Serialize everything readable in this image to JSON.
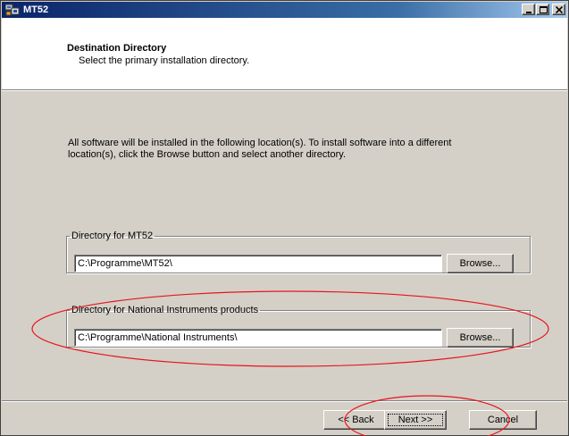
{
  "window": {
    "title": "MT52"
  },
  "header": {
    "title": "Destination Directory",
    "subtitle": "Select the primary installation directory."
  },
  "intro_text": "All software will be installed in the following location(s). To install software into a different location(s), click the Browse button and select another directory.",
  "groups": [
    {
      "label": "Directory for MT52",
      "path": "C:\\Programme\\MT52\\",
      "browse_label": "Browse..."
    },
    {
      "label": "Directory for National Instruments products",
      "path": "C:\\Programme\\National Instruments\\",
      "browse_label": "Browse..."
    }
  ],
  "footer": {
    "back_label": "<< Back",
    "next_label": "Next >>",
    "cancel_label": "Cancel"
  },
  "colors": {
    "titlebar_start": "#0a246a",
    "titlebar_end": "#a6caf0",
    "dialog_bg": "#d4d0c8",
    "annotation": "#e8141c"
  }
}
